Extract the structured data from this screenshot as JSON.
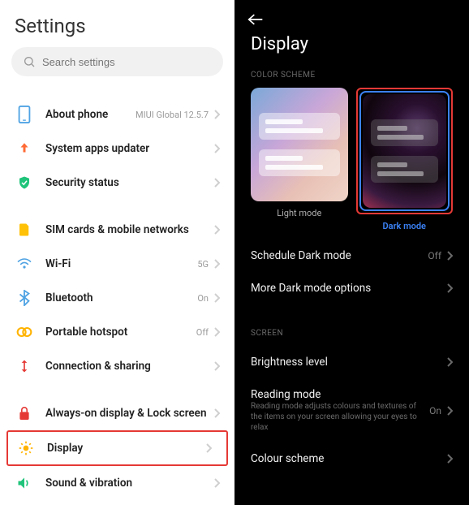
{
  "left": {
    "title": "Settings",
    "search_placeholder": "Search settings",
    "items": [
      {
        "label": "About phone",
        "value": "MIUI Global 12.5.7"
      },
      {
        "label": "System apps updater",
        "value": ""
      },
      {
        "label": "Security status",
        "value": ""
      },
      {
        "label": "SIM cards & mobile networks",
        "value": ""
      },
      {
        "label": "Wi-Fi",
        "value": "5G"
      },
      {
        "label": "Bluetooth",
        "value": "On"
      },
      {
        "label": "Portable hotspot",
        "value": "Off"
      },
      {
        "label": "Connection & sharing",
        "value": ""
      },
      {
        "label": "Always-on display & Lock screen",
        "value": ""
      },
      {
        "label": "Display",
        "value": ""
      },
      {
        "label": "Sound & vibration",
        "value": ""
      }
    ]
  },
  "right": {
    "title": "Display",
    "section_color": "COLOR SCHEME",
    "light_caption": "Light mode",
    "dark_caption": "Dark mode",
    "schedule_label": "Schedule Dark mode",
    "schedule_value": "Off",
    "more_dark_label": "More Dark mode options",
    "section_screen": "SCREEN",
    "brightness_label": "Brightness level",
    "reading_label": "Reading mode",
    "reading_sub": "Reading mode adjusts colours and textures of the items on your screen allowing your eyes to relax",
    "reading_value": "On",
    "colour_scheme_label": "Colour scheme"
  }
}
